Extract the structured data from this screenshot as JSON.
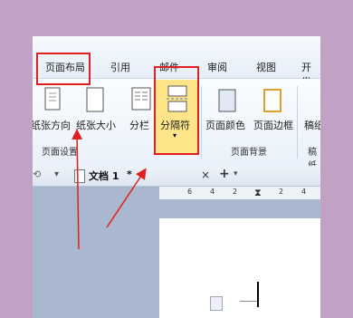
{
  "ribbon": {
    "tabs": [
      "页面布局",
      "引用",
      "邮件",
      "审阅",
      "视图",
      "开发工"
    ],
    "buttons": {
      "orientation": "纸张方向",
      "size": "纸张大小",
      "columns": "分栏",
      "breaks": "分隔符",
      "page_color": "页面颜色",
      "page_border": "页面边框",
      "manuscript": "稿纸"
    },
    "groups": {
      "page_setup": "页面设置",
      "page_background": "页面背景",
      "manuscript": "稿纸"
    }
  },
  "document_tab": {
    "title": "文档 1",
    "modified_mark": "*",
    "close": "×",
    "new": "+"
  },
  "ruler": {
    "ticks": [
      "6",
      "4",
      "2",
      "2",
      "4"
    ]
  },
  "colors": {
    "annotation": "#e02020",
    "breaks_highlight": "#ffe58a"
  }
}
